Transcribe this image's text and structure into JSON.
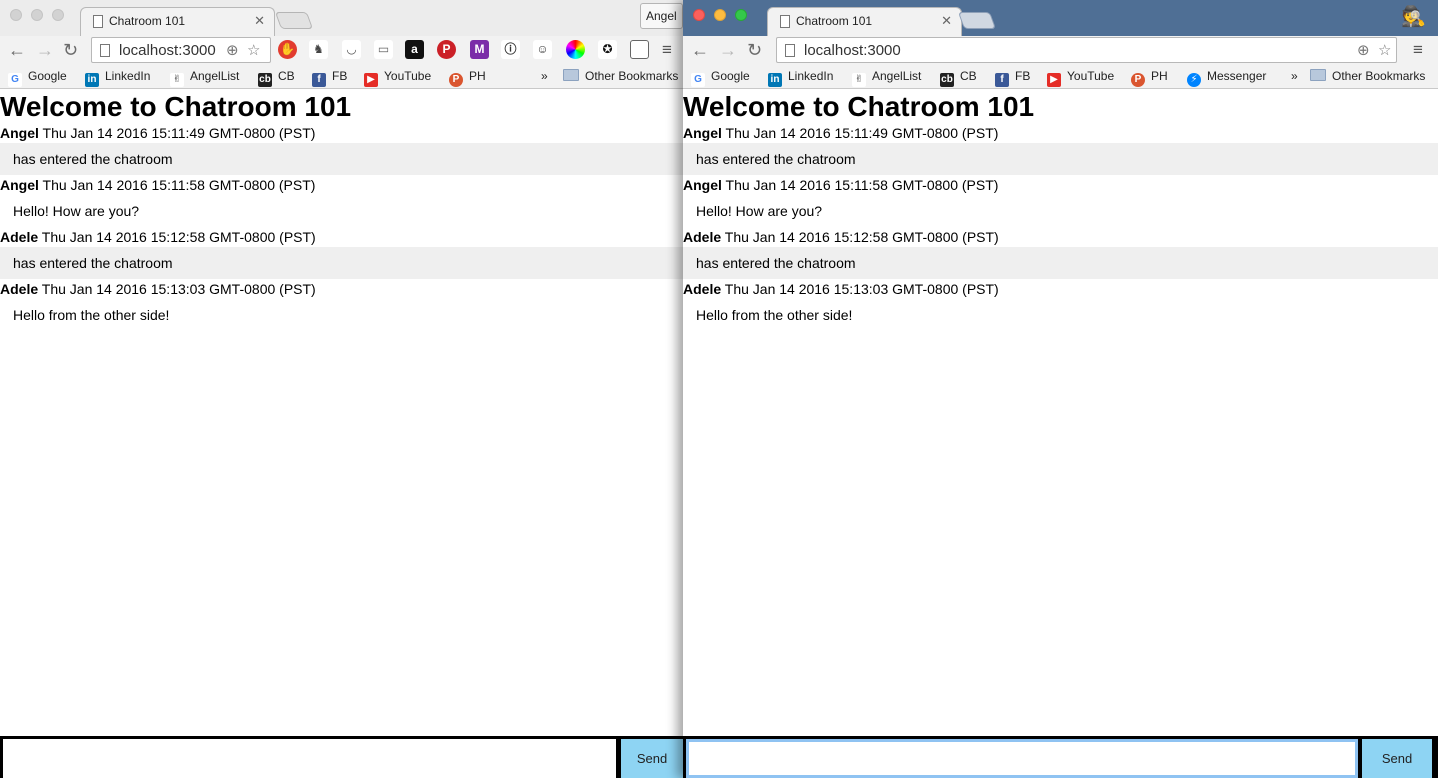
{
  "browser": {
    "tab_title": "Chatroom 101",
    "profile_name": "Angel",
    "url": "localhost:3000",
    "bookmarks_left": [
      "Google",
      "LinkedIn",
      "AngelList",
      "CB",
      "FB",
      "YouTube",
      "PH"
    ],
    "bookmarks_right": [
      "Google",
      "LinkedIn",
      "AngelList",
      "CB",
      "FB",
      "YouTube",
      "PH",
      "Messenger"
    ],
    "overflow": "»",
    "other_bookmarks": "Other Bookmarks"
  },
  "page": {
    "heading": "Welcome to Chatroom 101",
    "messages": [
      {
        "user": "Angel",
        "time": "Thu Jan 14 2016 15:11:49 GMT-0800 (PST)",
        "text": "has entered the chatroom"
      },
      {
        "user": "Angel",
        "time": "Thu Jan 14 2016 15:11:58 GMT-0800 (PST)",
        "text": "Hello! How are you?"
      },
      {
        "user": "Adele",
        "time": "Thu Jan 14 2016 15:12:58 GMT-0800 (PST)",
        "text": "has entered the chatroom"
      },
      {
        "user": "Adele",
        "time": "Thu Jan 14 2016 15:13:03 GMT-0800 (PST)",
        "text": "Hello from the other side!"
      }
    ],
    "send_label": "Send",
    "input_value": ""
  },
  "icons": [
    "back-icon",
    "forward-icon",
    "reload-icon",
    "page-icon",
    "zoom-icon",
    "star-icon",
    "menu-icon",
    "incognito-icon",
    "folder-icon"
  ],
  "colors": {
    "send_button": "#8ed4f3",
    "incognito_frame": "#4f6f95",
    "message_highlight": "#efefef"
  }
}
